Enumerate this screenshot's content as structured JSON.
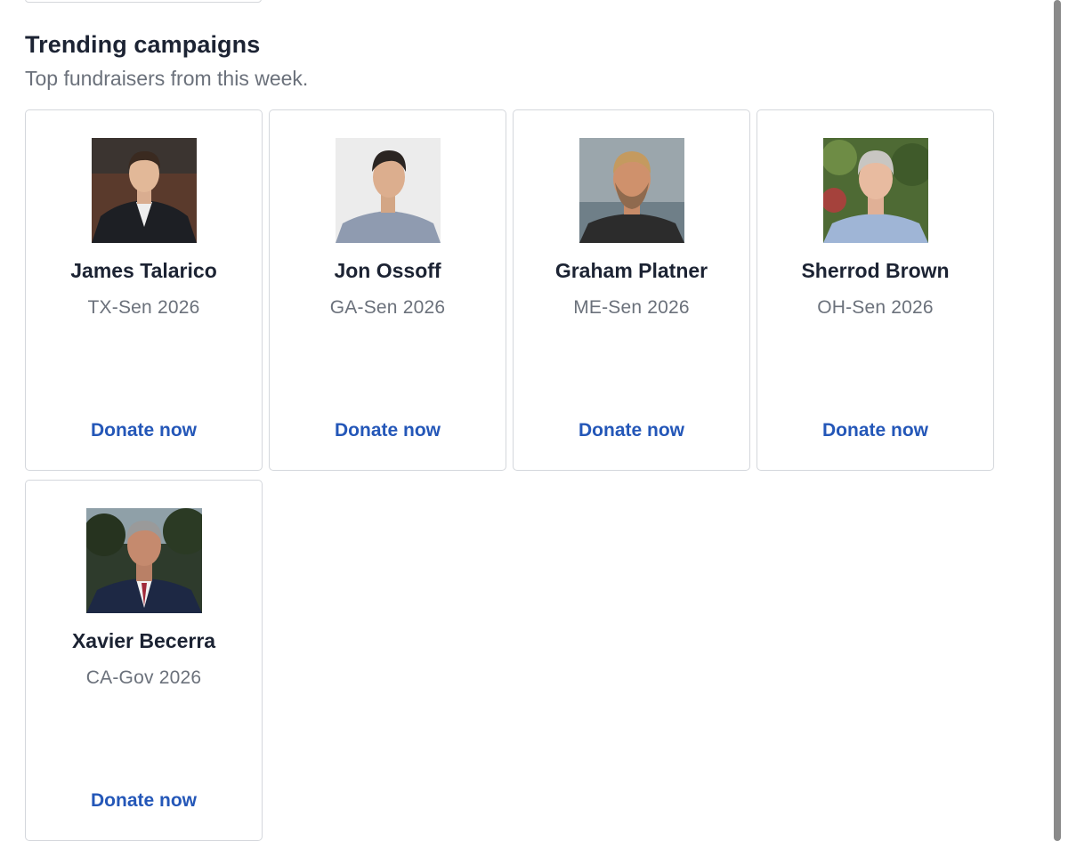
{
  "section": {
    "title": "Trending campaigns",
    "subtitle": "Top fundraisers from this week."
  },
  "campaigns": [
    {
      "name": "James Talarico",
      "race": "TX-Sen 2026",
      "donate_label": "Donate now"
    },
    {
      "name": "Jon Ossoff",
      "race": "GA-Sen 2026",
      "donate_label": "Donate now"
    },
    {
      "name": "Graham Platner",
      "race": "ME-Sen 2026",
      "donate_label": "Donate now"
    },
    {
      "name": "Sherrod Brown",
      "race": "OH-Sen 2026",
      "donate_label": "Donate now"
    },
    {
      "name": "Xavier Becerra",
      "race": "CA-Gov 2026",
      "donate_label": "Donate now"
    }
  ],
  "colors": {
    "link": "#2457b8",
    "heading": "#1c2333",
    "muted": "#6b717b",
    "card_border": "#d4d7dc"
  }
}
